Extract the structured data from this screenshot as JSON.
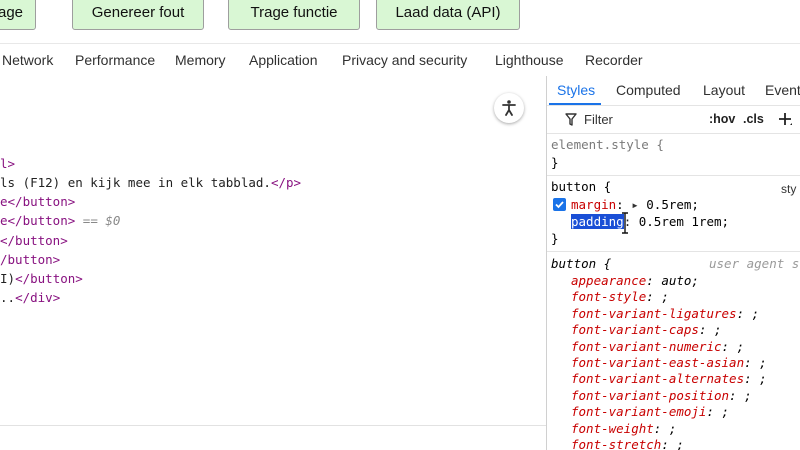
{
  "page_buttons": [
    "rage",
    "Genereer fout",
    "Trage functie",
    "Laad data (API)"
  ],
  "devtools_tabs": [
    "Network",
    "Performance",
    "Memory",
    "Application",
    "Privacy and security",
    "Lighthouse",
    "Recorder"
  ],
  "code_lines": [
    {
      "a": "l>",
      "b": "",
      "c": ""
    },
    {
      "a": "ls (F12) en kijk mee in elk tabblad.",
      "b": "</p>",
      "c": ""
    },
    {
      "a": "e",
      "b": "</button>",
      "c": ""
    },
    {
      "a": "e",
      "b": "</button>",
      "c": " == $0"
    },
    {
      "a": "",
      "b": "</button>",
      "c": ""
    },
    {
      "a": "",
      "b": "/button>",
      "c": ""
    },
    {
      "a": "I)",
      "b": "</button>",
      "c": ""
    },
    {
      "a": "..",
      "b": "</div>",
      "c": ""
    }
  ],
  "styles": {
    "tabs": [
      "Styles",
      "Computed",
      "Layout",
      "Event"
    ],
    "filter_placeholder": "Filter",
    "hov": ":hov",
    "cls": ".cls",
    "element_style": "element.style {",
    "close_brace": "}",
    "button_rule": "button {",
    "source_short": "sty",
    "margin_name": "margin",
    "margin_value": "0.5rem;",
    "padding_name": "padding",
    "padding_value": "0.5rem 1rem;",
    "ua_rule": "button {",
    "ua_label": "user agent st",
    "ua_props": [
      {
        "name": "appearance",
        "value": " auto;"
      },
      {
        "name": "font-style",
        "value": " ;"
      },
      {
        "name": "font-variant-ligatures",
        "value": " ;"
      },
      {
        "name": "font-variant-caps",
        "value": " ;"
      },
      {
        "name": "font-variant-numeric",
        "value": " ;"
      },
      {
        "name": "font-variant-east-asian",
        "value": " ;"
      },
      {
        "name": "font-variant-alternates",
        "value": " ;"
      },
      {
        "name": "font-variant-position",
        "value": " ;"
      },
      {
        "name": "font-variant-emoji",
        "value": " ;"
      },
      {
        "name": "font-weight",
        "value": " ;"
      },
      {
        "name": "font-stretch",
        "value": " ;"
      }
    ]
  },
  "colors": {
    "accent": "#1a73e8",
    "tag": "#881280",
    "prop": "#c80000",
    "button_bg": "#d9f7d4"
  }
}
